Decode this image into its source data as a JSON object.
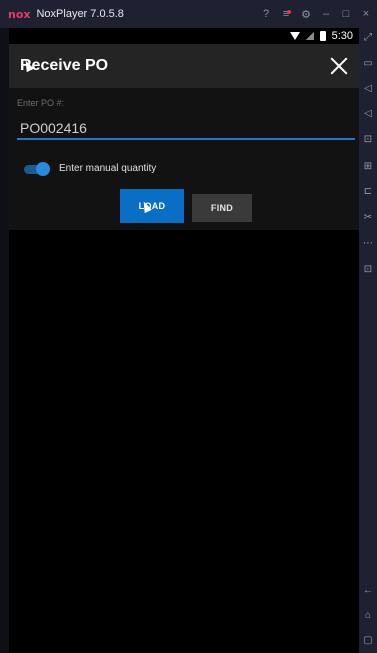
{
  "window": {
    "logo": "nox",
    "title": "NoxPlayer 7.0.5.8",
    "controls": {
      "help_icon": "?",
      "menu_icon": "≡",
      "settings_icon": "⚙",
      "minimize_icon": "–",
      "maximize_icon": "□",
      "close_icon": "×"
    }
  },
  "statusbar": {
    "time": "5:30"
  },
  "appbar": {
    "title": "Receive PO",
    "close_icon": "close-icon"
  },
  "form": {
    "po_label": "Enter PO #:",
    "po_value": "PO002416",
    "manual_quantity_label": "Enter manual quantity",
    "manual_quantity_on": true,
    "load_label": "LOAD",
    "find_label": "FIND"
  },
  "colors": {
    "accent": "#0a6fc4",
    "toggle_thumb": "#2a8ae0",
    "appbar": "#242424",
    "chrome": "#1f2133",
    "nox_brand": "#e23a6a"
  }
}
